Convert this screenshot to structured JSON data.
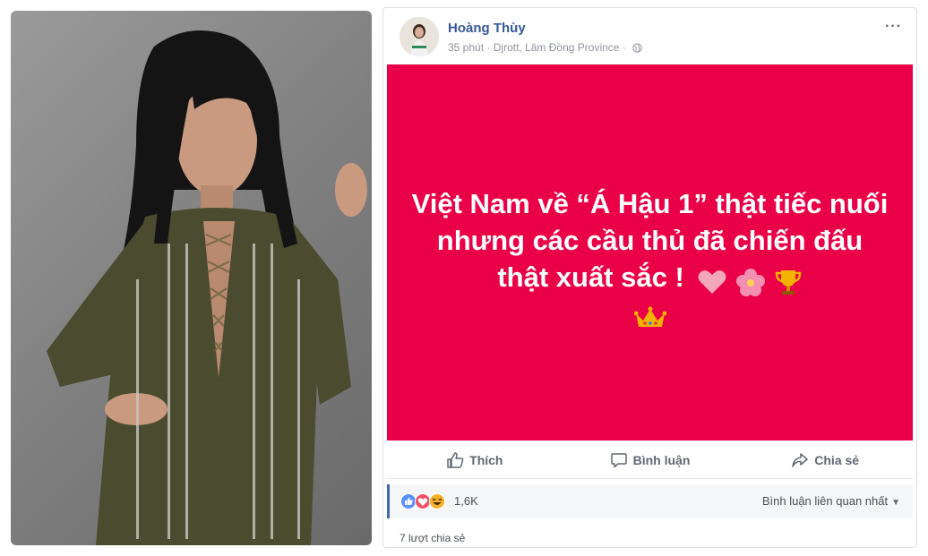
{
  "post": {
    "author": "Hoàng Thùy",
    "time": "35 phút",
    "separator": "·",
    "location": "Djrott, Lâm Đồng Province",
    "more": "···",
    "text": "Việt Nam về “Á Hậu 1” thật tiếc nuối nhưng các cầu thủ đã chiến đấu thật xuất sắc !",
    "bg_color": "#ea0046"
  },
  "actions": {
    "like": "Thích",
    "comment": "Bình luận",
    "share": "Chia sẻ"
  },
  "reactions": {
    "count": "1,6K",
    "sort_label": "Bình luận liên quan nhất",
    "icons": [
      "like-icon",
      "love-icon",
      "haha-icon"
    ]
  },
  "shares": "7 lượt chia sẻ",
  "photo": {
    "subject": "woman-in-olive-dress",
    "background": "#8a8a8a"
  }
}
